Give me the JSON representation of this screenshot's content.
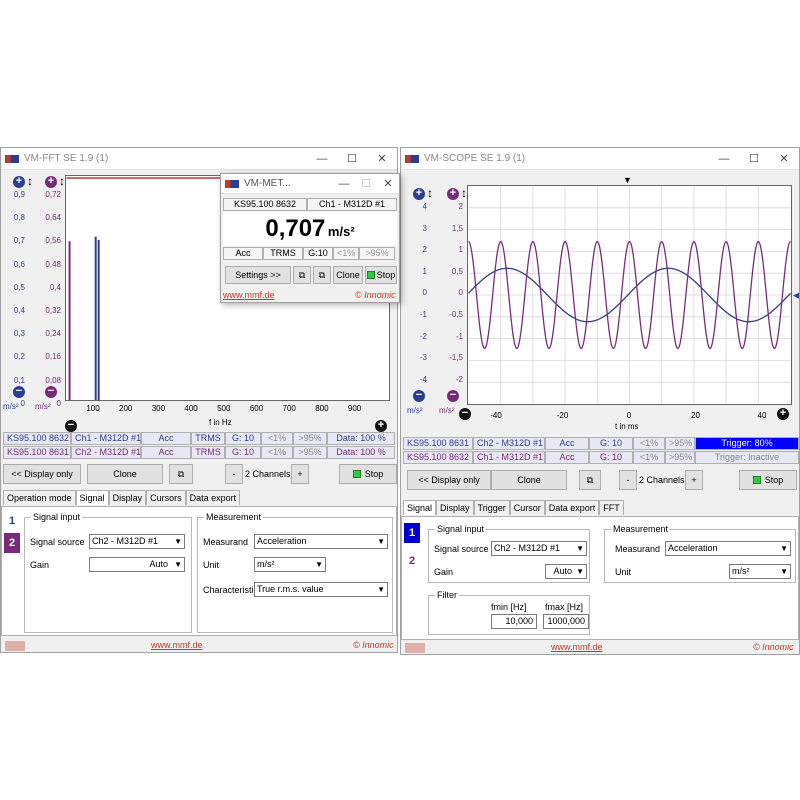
{
  "fft": {
    "title": "VM-FFT SE 1.9 (1)",
    "yticks_blue": [
      "0,9",
      "0,8",
      "0,7",
      "0,6",
      "0,5",
      "0,4",
      "0,3",
      "0,2",
      "0,1",
      "0"
    ],
    "yticks_purple": [
      "0,72",
      "0,64",
      "0,56",
      "0,48",
      "0,4",
      "0,32",
      "0,24",
      "0,16",
      "0,08",
      "0"
    ],
    "xticks": [
      "100",
      "200",
      "300",
      "400",
      "500",
      "600",
      "700",
      "800",
      "900"
    ],
    "xlabel": "f in Hz",
    "unit1": "m/s²",
    "unit2": "m/s²",
    "ch1": {
      "sensor": "KS95.100 8632",
      "channel": "Ch1 - M312D #1",
      "measurand": "Acc",
      "char": "TRMS",
      "gain": "G: 10",
      "lo": "<1%",
      "hi": ">95%",
      "data": "Data: 100 %"
    },
    "ch2": {
      "sensor": "KS95.100 8631",
      "channel": "Ch2 - M312D #1",
      "measurand": "Acc",
      "char": "TRMS",
      "gain": "G: 10",
      "lo": "<1%",
      "hi": ">95%",
      "data": "Data: 100 %"
    },
    "display_only": "<< Display only",
    "clone": "Clone",
    "minus": "-",
    "channels": "2 Channels",
    "plus": "+",
    "stop": "Stop",
    "tabs": [
      "Operation mode",
      "Signal",
      "Display",
      "Cursors",
      "Data export"
    ],
    "active_tab": "Signal",
    "channel_numbers": [
      "1",
      "2"
    ],
    "signal_input": "Signal input",
    "signal_source_label": "Signal source",
    "signal_source": "Ch2 - M312D #1",
    "gain_label": "Gain",
    "gain": "Auto",
    "measurement": "Measurement",
    "measurand_label": "Measurand",
    "measurand": "Acceleration",
    "unit_label": "Unit",
    "unit": "m/s²",
    "characteristic_label": "Characteristic",
    "characteristic": "True r.m.s. value",
    "footer_link": "www.mmf.de",
    "footer_copy": "© Innomic"
  },
  "meter": {
    "title": "VM-MET...",
    "sensor": "KS95.100 8632",
    "channel": "Ch1 - M312D #1",
    "value": "0,707",
    "unit": "m/s²",
    "measurand": "Acc",
    "char": "TRMS",
    "gain": "G:10",
    "lo": "<1%",
    "hi": ">95%",
    "settings": "Settings >>",
    "clone": "Clone",
    "stop": "Stop",
    "footer_link": "www.mmf.de",
    "footer_copy": "© Innomic"
  },
  "scope": {
    "title": "VM-SCOPE SE 1.9 (1)",
    "yticks_blue": [
      "4",
      "3",
      "2",
      "1",
      "0",
      "-1",
      "-2",
      "-3",
      "-4"
    ],
    "yticks_purple": [
      "2",
      "1,5",
      "1",
      "0,5",
      "0",
      "-0,5",
      "-1",
      "-1,5",
      "-2"
    ],
    "xticks": [
      "-40",
      "-20",
      "0",
      "20",
      "40"
    ],
    "xlabel": "t in ms",
    "unit1": "m/s²",
    "unit2": "m/s²",
    "ch1": {
      "sensor": "KS95.100 8631",
      "channel": "Ch2 - M312D #1",
      "measurand": "Acc",
      "gain": "G: 10",
      "lo": "<1%",
      "hi": ">95%",
      "trigger": "Trigger: 80%"
    },
    "ch2": {
      "sensor": "KS95.100 8632",
      "channel": "Ch1 - M312D #1",
      "measurand": "Acc",
      "gain": "G: 10",
      "lo": "<1%",
      "hi": ">95%",
      "trigger": "Trigger: Inactive"
    },
    "display_only": "<< Display only",
    "clone": "Clone",
    "minus": "-",
    "channels": "2 Channels",
    "plus": "+",
    "stop": "Stop",
    "tabs": [
      "Signal",
      "Display",
      "Trigger",
      "Cursor",
      "Data export",
      "FFT"
    ],
    "active_tab": "Signal",
    "channel_numbers": [
      "1",
      "2"
    ],
    "signal_input": "Signal input",
    "signal_source_label": "Signal source",
    "signal_source": "Ch2 - M312D #1",
    "gain_label": "Gain",
    "gain": "Auto",
    "measurement": "Measurement",
    "measurand_label": "Measurand",
    "measurand": "Acceleration",
    "unit_label": "Unit",
    "unit": "m/s²",
    "filter": "Filter",
    "fmin_label": "fmin [Hz]",
    "fmax_label": "fmax [Hz]",
    "fmin": "10,000",
    "fmax": "1000,000",
    "footer_link": "www.mmf.de",
    "footer_copy": "© Innomic"
  },
  "chart_data": [
    {
      "type": "bar",
      "xlabel": "f in Hz",
      "xlim": [
        0,
        1000
      ],
      "ylim": [
        0,
        0.9
      ],
      "series": [
        {
          "color": "#7a2a7a",
          "x": [
            10
          ],
          "values": [
            0.7
          ]
        },
        {
          "color": "#2c3e90",
          "x": [
            100
          ],
          "values": [
            0.72
          ]
        }
      ]
    },
    {
      "type": "line",
      "xlabel": "t in ms",
      "xlim": [
        -50,
        50
      ],
      "ylim": [
        -4,
        4
      ],
      "series": [
        {
          "color": "#2c3e90",
          "frequency_hz": 20,
          "amplitude": 1,
          "peak_ms": 12
        },
        {
          "color": "#7a2a7a",
          "frequency_hz": 100,
          "amplitude": 2,
          "peak_ms": 0
        }
      ]
    }
  ],
  "colors": {
    "ch1": "#2c3e90",
    "ch2": "#7a2a7a",
    "stop": "#2ecc40",
    "accent": "#c0392b",
    "trigger": "#0000ff"
  }
}
